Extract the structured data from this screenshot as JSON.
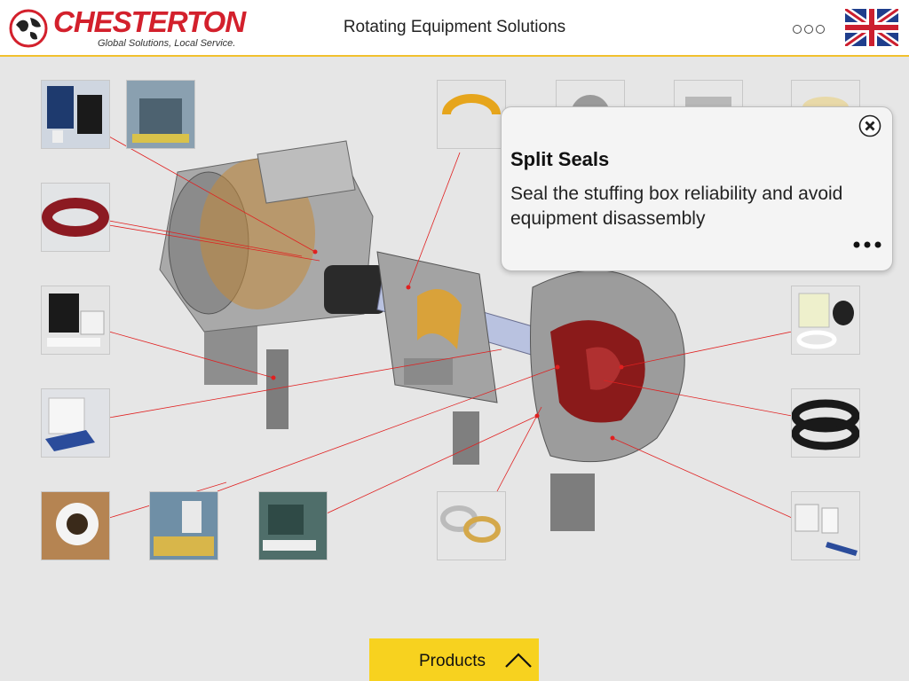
{
  "header": {
    "brand": "CHESTERTON",
    "tagline": "Global Solutions, Local Service.",
    "title": "Rotating Equipment Solutions",
    "menu_icon": "three-circles-menu-icon",
    "language_icon": "uk-flag-icon"
  },
  "popup": {
    "title": "Split Seals",
    "description": "Seal the stuffing box reliability and avoid equipment disassembly",
    "close_icon": "close-circle-icon",
    "more_icon": "ellipsis-icon"
  },
  "footer": {
    "products_label": "Products",
    "chevron_icon": "chevron-up-icon"
  },
  "colors": {
    "brand_red": "#d3202c",
    "accent_yellow": "#f7d21f",
    "callout_line": "#e02020"
  }
}
